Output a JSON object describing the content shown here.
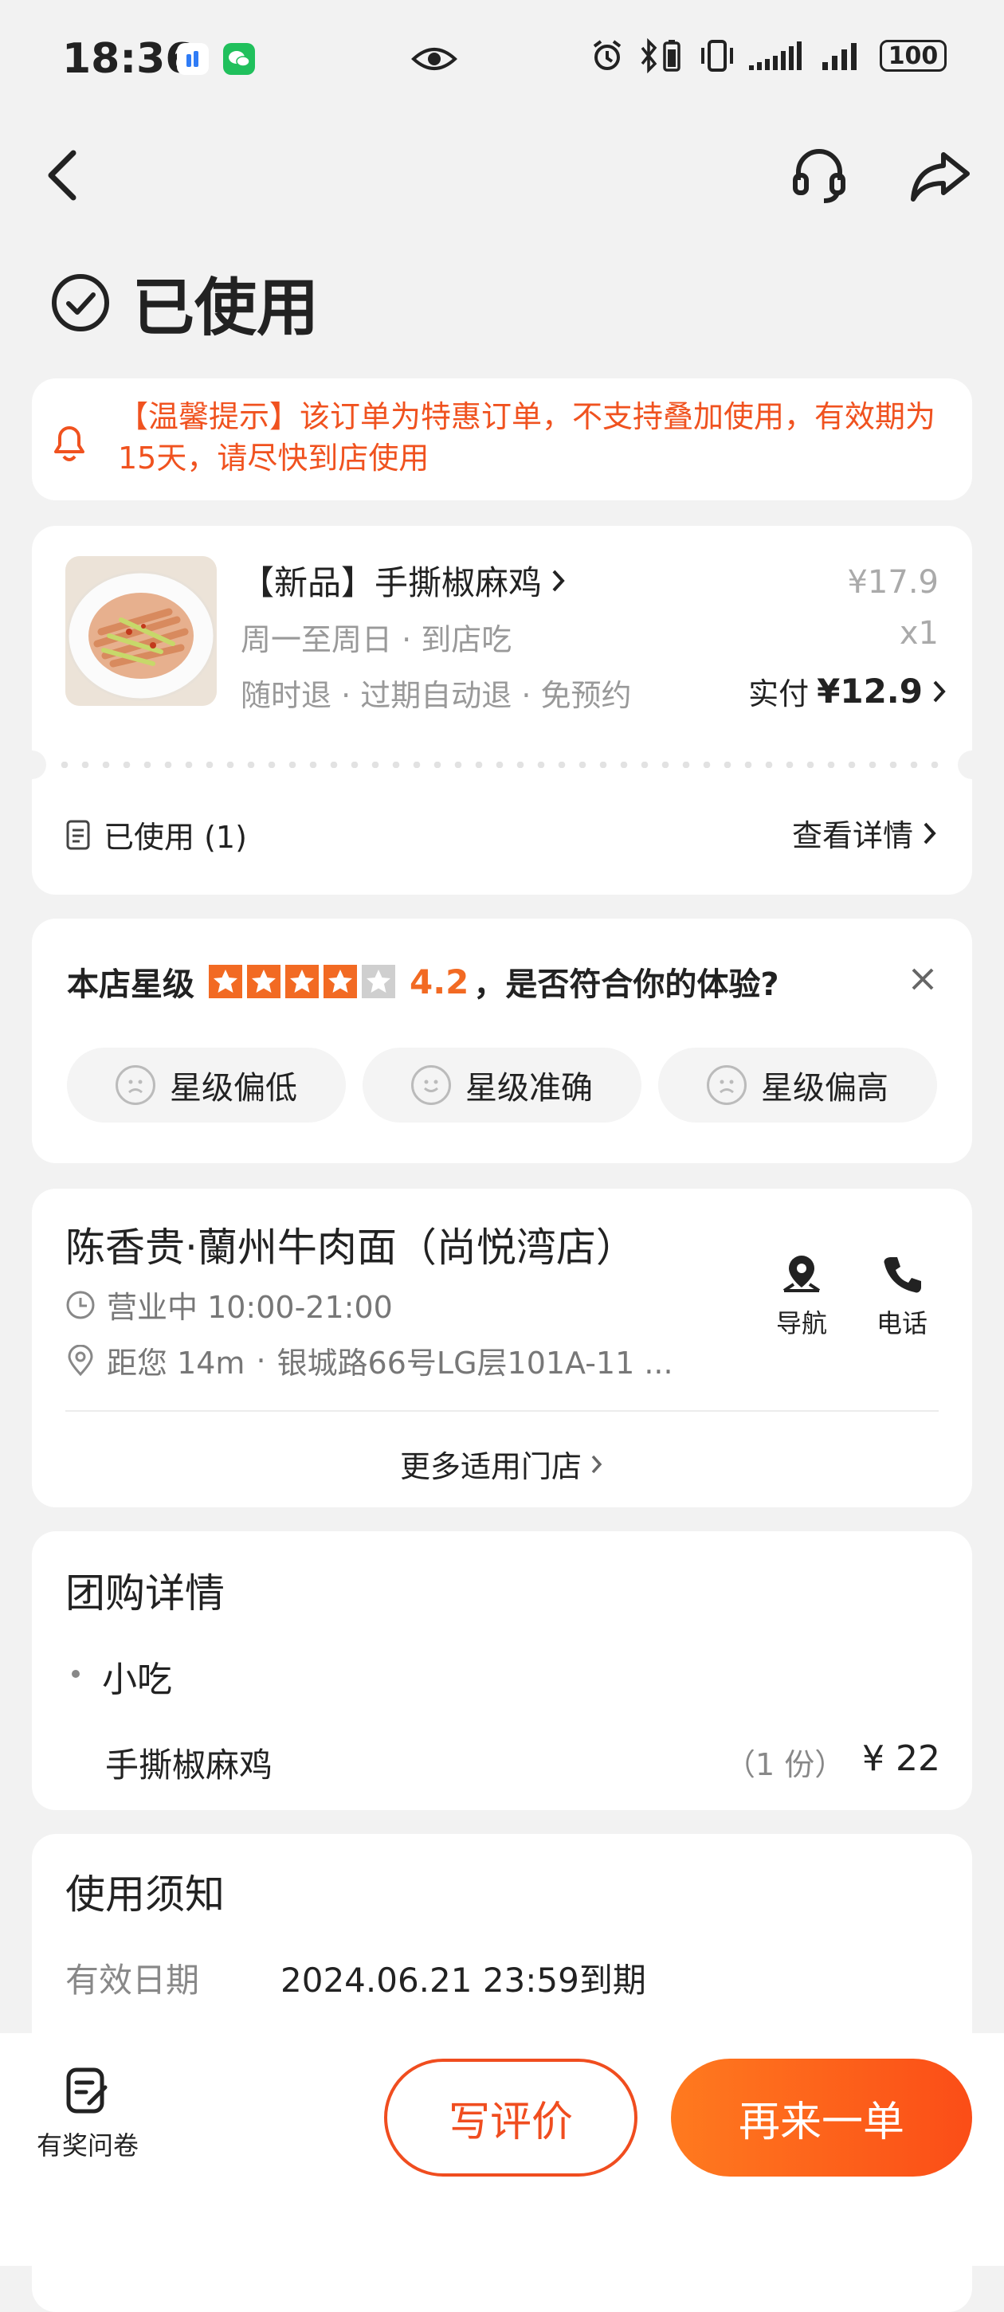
{
  "status_bar": {
    "time": "18:36",
    "battery": "100"
  },
  "page": {
    "title": "已使用"
  },
  "tip": {
    "text": "【温馨提示】该订单为特惠订单，不支持叠加使用，有效期为15天，请尽快到店使用"
  },
  "order": {
    "product_name": "【新品】手撕椒麻鸡",
    "meta1": "周一至周日 · 到店吃",
    "meta2": "随时退 · 过期自动退 · 免预约",
    "original_price": "¥17.9",
    "quantity": "x1",
    "paid_label": "实付",
    "paid_amount": "¥12.9",
    "used_label": "已使用 (1)",
    "detail_link": "查看详情"
  },
  "rating": {
    "label": "本店星级",
    "score": "4.2",
    "stars_value": 4.2,
    "question": "，是否符合你的体验?",
    "options": [
      "星级偏低",
      "星级准确",
      "星级偏高"
    ]
  },
  "store": {
    "name": "陈香贵·蘭州牛肉面（尚悦湾店）",
    "hours": "营业中 10:00-21:00",
    "distance": "距您 14m",
    "address": "银城路66号LG层101A-11 ...",
    "nav_label": "导航",
    "phone_label": "电话",
    "more_stores": "更多适用门店"
  },
  "group": {
    "title": "团购详情",
    "category": "小吃",
    "item_name": "手撕椒麻鸡",
    "item_qty": "（1 份）",
    "item_price": "¥ 22"
  },
  "usage": {
    "title": "使用须知",
    "validity_label": "有效日期",
    "validity_value": "2024.06.21 23:59到期"
  },
  "bottom": {
    "survey_label": "有奖问卷",
    "review_button": "写评价",
    "reorder_button": "再来一单"
  },
  "colors": {
    "accent": "#f0521f",
    "button_gradient_start": "#ff7a1f",
    "button_gradient_end": "#fb4d17"
  }
}
